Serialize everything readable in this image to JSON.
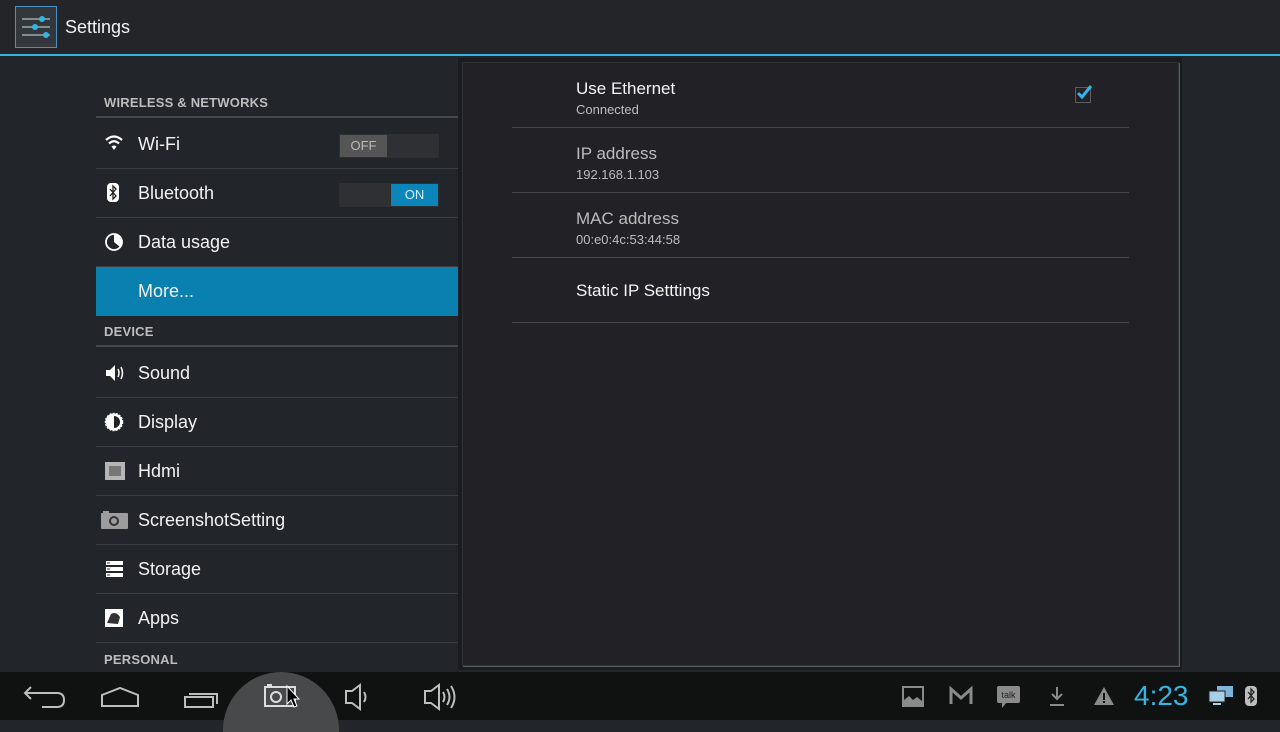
{
  "action_bar": {
    "title": "Settings",
    "icon": "settings-sliders-icon"
  },
  "sidebar": {
    "sections": [
      {
        "header": "WIRELESS & NETWORKS",
        "items": [
          {
            "label": "Wi-Fi",
            "icon": "wifi-icon",
            "toggle": "OFF"
          },
          {
            "label": "Bluetooth",
            "icon": "bluetooth-icon",
            "toggle": "ON"
          },
          {
            "label": "Data usage",
            "icon": "data-usage-icon"
          },
          {
            "label": "More...",
            "icon": "",
            "selected": true
          }
        ]
      },
      {
        "header": "DEVICE",
        "items": [
          {
            "label": "Sound",
            "icon": "sound-icon"
          },
          {
            "label": "Display",
            "icon": "display-brightness-icon"
          },
          {
            "label": "Hdmi",
            "icon": "hdmi-icon"
          },
          {
            "label": "ScreenshotSetting",
            "icon": "camera-icon"
          },
          {
            "label": "Storage",
            "icon": "storage-icon"
          },
          {
            "label": "Apps",
            "icon": "apps-icon"
          }
        ]
      },
      {
        "header": "PERSONAL",
        "items": []
      }
    ]
  },
  "detail": {
    "items": [
      {
        "title": "Use Ethernet",
        "summary": "Connected",
        "checked": true
      },
      {
        "title": "IP address",
        "summary": "192.168.1.103"
      },
      {
        "title": "MAC address",
        "summary": "00:e0:4c:53:44:58"
      },
      {
        "title": "Static IP Setttings",
        "summary": ""
      }
    ]
  },
  "navbar": {
    "buttons": [
      "back-icon",
      "home-icon",
      "recent-apps-icon",
      "screenshot-icon",
      "volume-down-icon",
      "volume-up-icon"
    ],
    "notifications": [
      "gallery-icon",
      "gmail-icon",
      "talk-icon",
      "download-icon",
      "warning-icon"
    ],
    "talk_label": "talk",
    "clock": "4:23",
    "status_icons": [
      "ethernet-icon",
      "bluetooth-status-icon"
    ]
  },
  "colors": {
    "accent": "#33b5e5",
    "selected": "#0a80b0"
  }
}
